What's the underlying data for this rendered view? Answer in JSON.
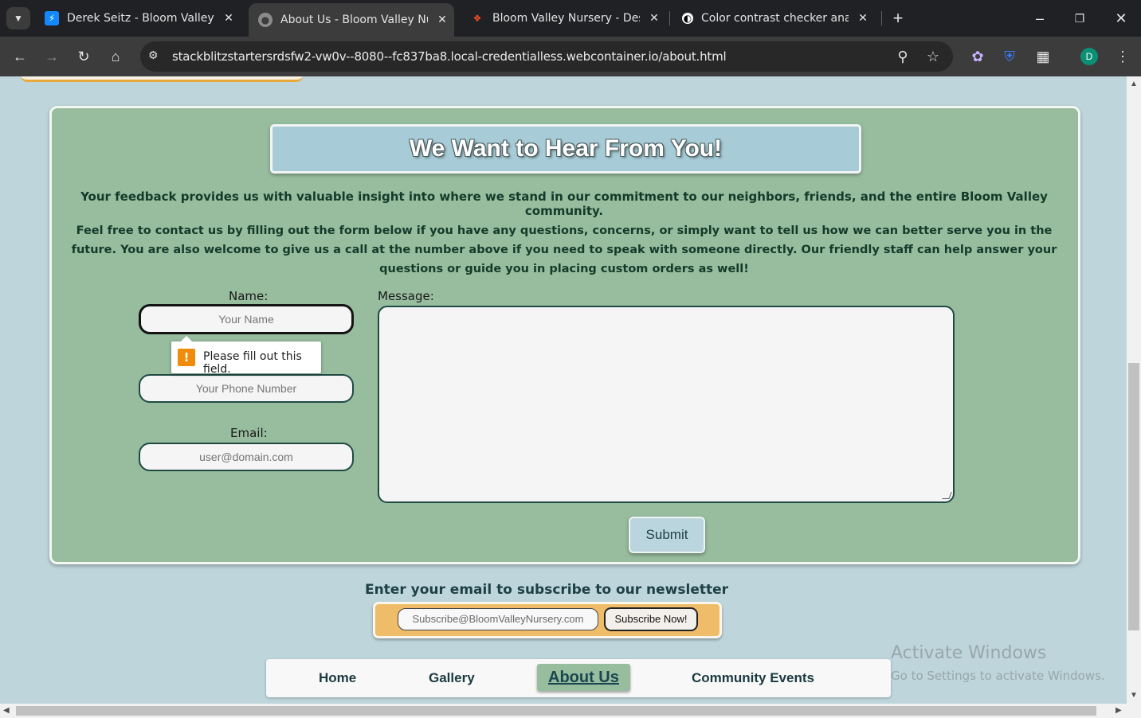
{
  "browser": {
    "tabs": [
      {
        "title": "Derek Seitz - Bloom Valley Nurs",
        "icon": "stackblitz-icon"
      },
      {
        "title": "About Us - Bloom Valley Nurser",
        "icon": "globe-icon"
      },
      {
        "title": "Bloom Valley Nursery - Desktop",
        "icon": "figma-icon"
      },
      {
        "title": "Color contrast checker analyzer",
        "icon": "contrast-icon"
      }
    ],
    "url": "stackblitzstartersrdsfw2-vw0v--8080--fc837ba8.local-credentialless.webcontainer.io/about.html",
    "profile_initial": "D"
  },
  "feedback": {
    "title": "We Want to Hear From You!",
    "intro": "Your feedback provides us with valuable insight into where we stand in our commitment to our neighbors, friends, and the entire Bloom Valley community.",
    "body": "Feel free to contact us by filling out the form below if you have any questions, concerns, or simply want to tell us how we can better serve you in the future. You are also welcome to give us a call at the number above if you need to speak with someone directly. Our friendly staff can help answer your questions or guide you in placing custom orders as well!",
    "name_label": "Name:",
    "name_placeholder": "Your Name",
    "phone_placeholder": "Your Phone Number",
    "email_label": "Email:",
    "email_placeholder": "user@domain.com",
    "message_label": "Message:",
    "submit_label": "Submit",
    "validation_message": "Please fill out this field."
  },
  "newsletter": {
    "title": "Enter your email to subscribe to our newsletter",
    "placeholder": "Subscribe@BloomValleyNursery.com",
    "button_label": "Subscribe Now!"
  },
  "nav": {
    "items": [
      "Home",
      "Gallery",
      "About Us",
      "Community Events"
    ],
    "active": "About Us"
  },
  "watermark": {
    "line1": "Activate Windows",
    "line2": "Go to Settings to activate Windows."
  },
  "colors": {
    "page_bg": "#bdd5db",
    "panel_bg": "#97bc9e",
    "banner_bg": "#a7ccd8",
    "newsletter_bg": "#efbd69"
  }
}
